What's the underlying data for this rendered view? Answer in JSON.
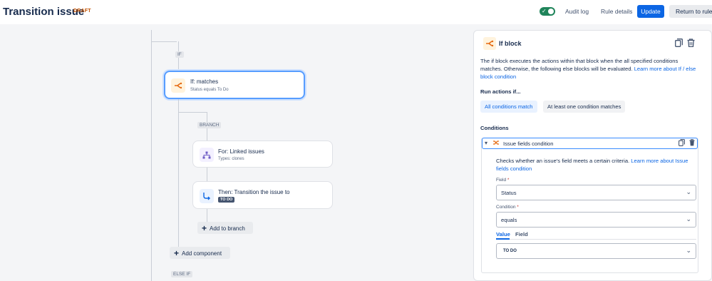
{
  "header": {
    "title": "Transition issue",
    "draft": "DRAFT",
    "audit_log": "Audit log",
    "rule_details": "Rule details",
    "update": "Update",
    "return": "Return to rules"
  },
  "canvas": {
    "if_tag": "IF",
    "branch_tag": "BRANCH",
    "else_if_tag": "ELSE IF",
    "if_card": {
      "title": "If: matches",
      "subtitle": "Status equals To Do",
      "icon": "if-branch-icon"
    },
    "for_card": {
      "title": "For: Linked issues",
      "subtitle": "Types: clones",
      "icon": "hierarchy-icon"
    },
    "then_card": {
      "title": "Then: Transition the issue to",
      "lozenge": "TO DO",
      "icon": "transition-icon"
    },
    "add_to_branch": "Add to branch",
    "add_component": "Add component"
  },
  "panel": {
    "title": "If block",
    "description": "The if block executes the actions within that block when the all specified conditions matches. Otherwise, the following else blocks will be evaluated.",
    "learn_more": "Learn more about If / else block condition",
    "run_actions": "Run actions if...",
    "all_conditions": "All conditions match",
    "at_least_one": "At least one condition matches",
    "conditions_heading": "Conditions",
    "condition_item": {
      "title": "Issue fields condition",
      "description": "Checks whether an issue's field meets a certain criteria.",
      "learn_more": "Learn more about Issue fields condition",
      "field_label": "Field",
      "field_value": "Status",
      "condition_label": "Condition",
      "condition_value": "equals",
      "tab_value": "Value",
      "tab_field": "Field",
      "value_value": "TO DO"
    }
  },
  "colors": {
    "primary": "#0c66e4",
    "toggle_on": "#1f845a",
    "draft": "#c25100",
    "if_icon_bg": "#fff3dd",
    "if_icon": "#e56910"
  }
}
